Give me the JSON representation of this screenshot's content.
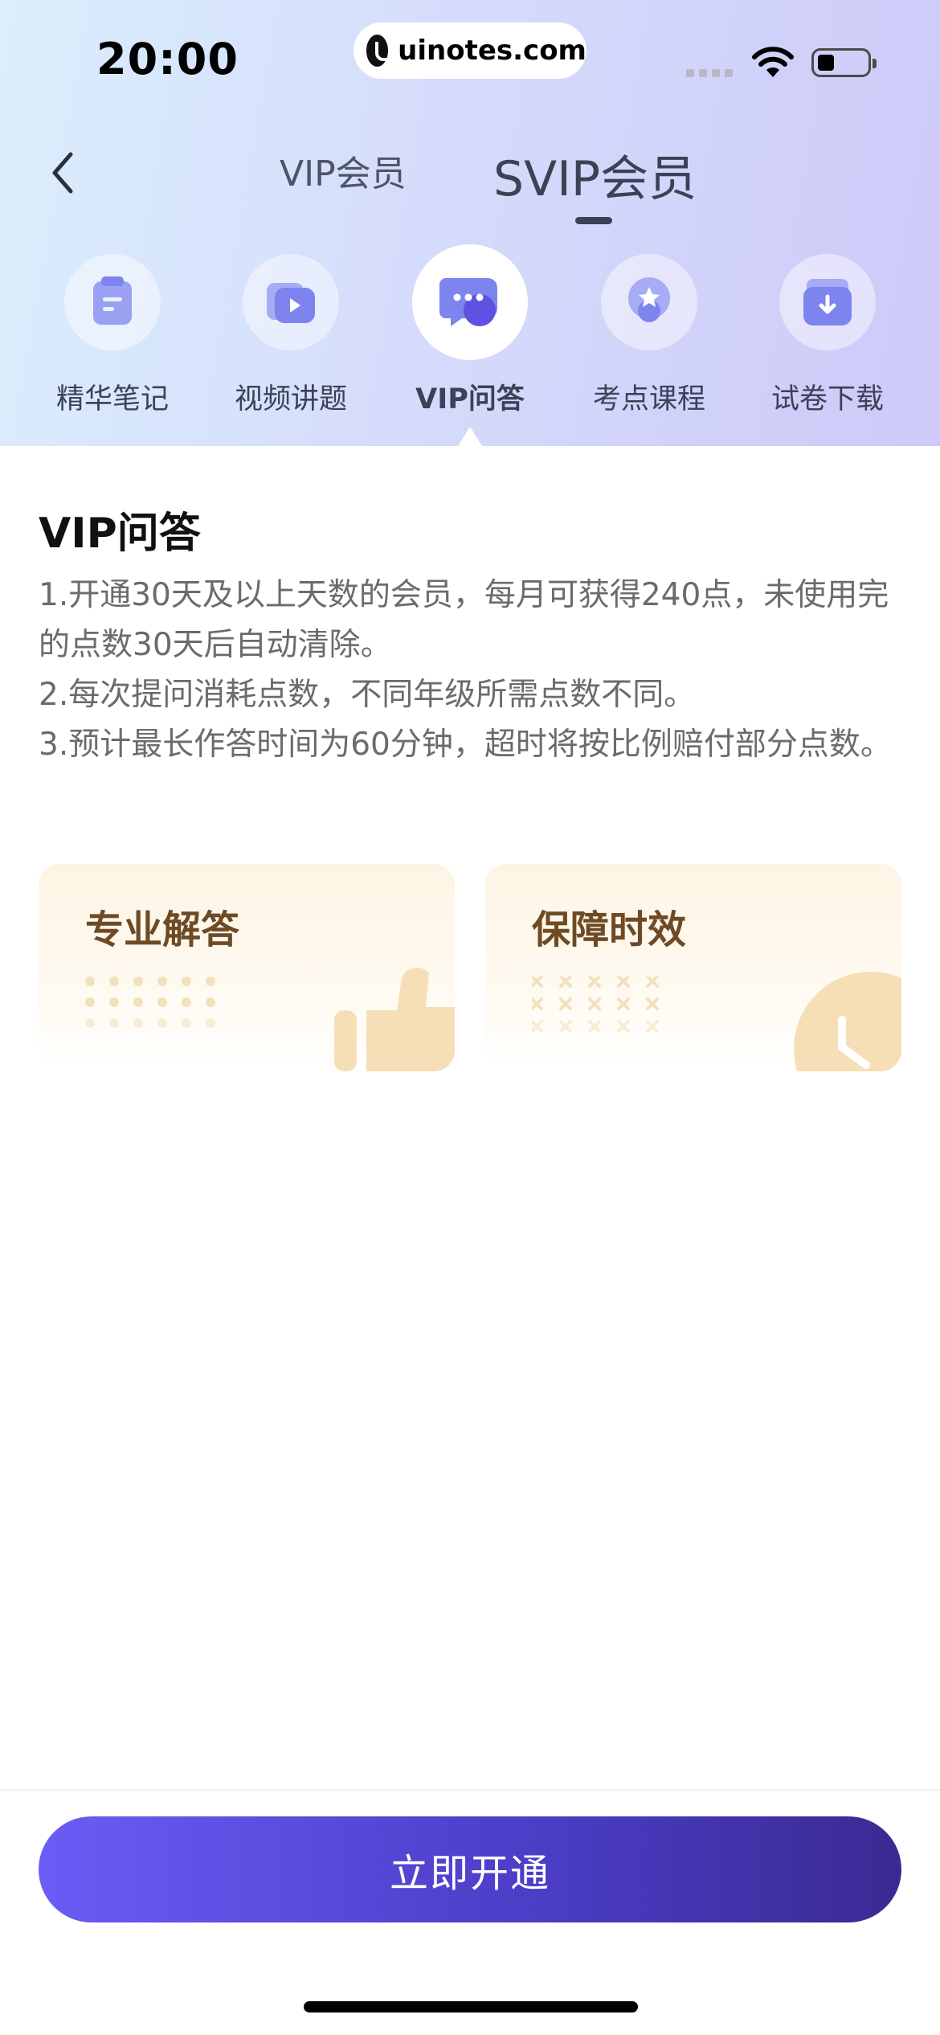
{
  "status_bar": {
    "time": "20:00",
    "watermark": "uinotes.com"
  },
  "nav": {
    "tabs": [
      {
        "label": "VIP会员"
      },
      {
        "label": "SVIP会员"
      }
    ],
    "active_tab": "SVIP会员"
  },
  "features": [
    {
      "label": "精华笔记",
      "icon": "note-icon"
    },
    {
      "label": "视频讲题",
      "icon": "video-icon"
    },
    {
      "label": "VIP问答",
      "icon": "chat-icon",
      "active": true
    },
    {
      "label": "考点课程",
      "icon": "course-icon"
    },
    {
      "label": "试卷下载",
      "icon": "download-icon"
    }
  ],
  "detail": {
    "title": "VIP问答",
    "lines": [
      "1.开通30天及以上天数的会员，每月可获得240点，未使用完的点数30天后自动清除。",
      "2.每次提问消耗点数，不同年级所需点数不同。",
      "3.预计最长作答时间为60分钟，超时将按比例赔付部分点数。"
    ]
  },
  "cards": [
    {
      "title": "专业解答",
      "icon": "thumbs-up-icon"
    },
    {
      "title": "保障时效",
      "icon": "clock-icon"
    }
  ],
  "cta": {
    "label": "立即开通"
  },
  "colors": {
    "accent": "#5b4ee6",
    "card_title": "#6e4a25",
    "icon_purple": "#6f73f0"
  }
}
